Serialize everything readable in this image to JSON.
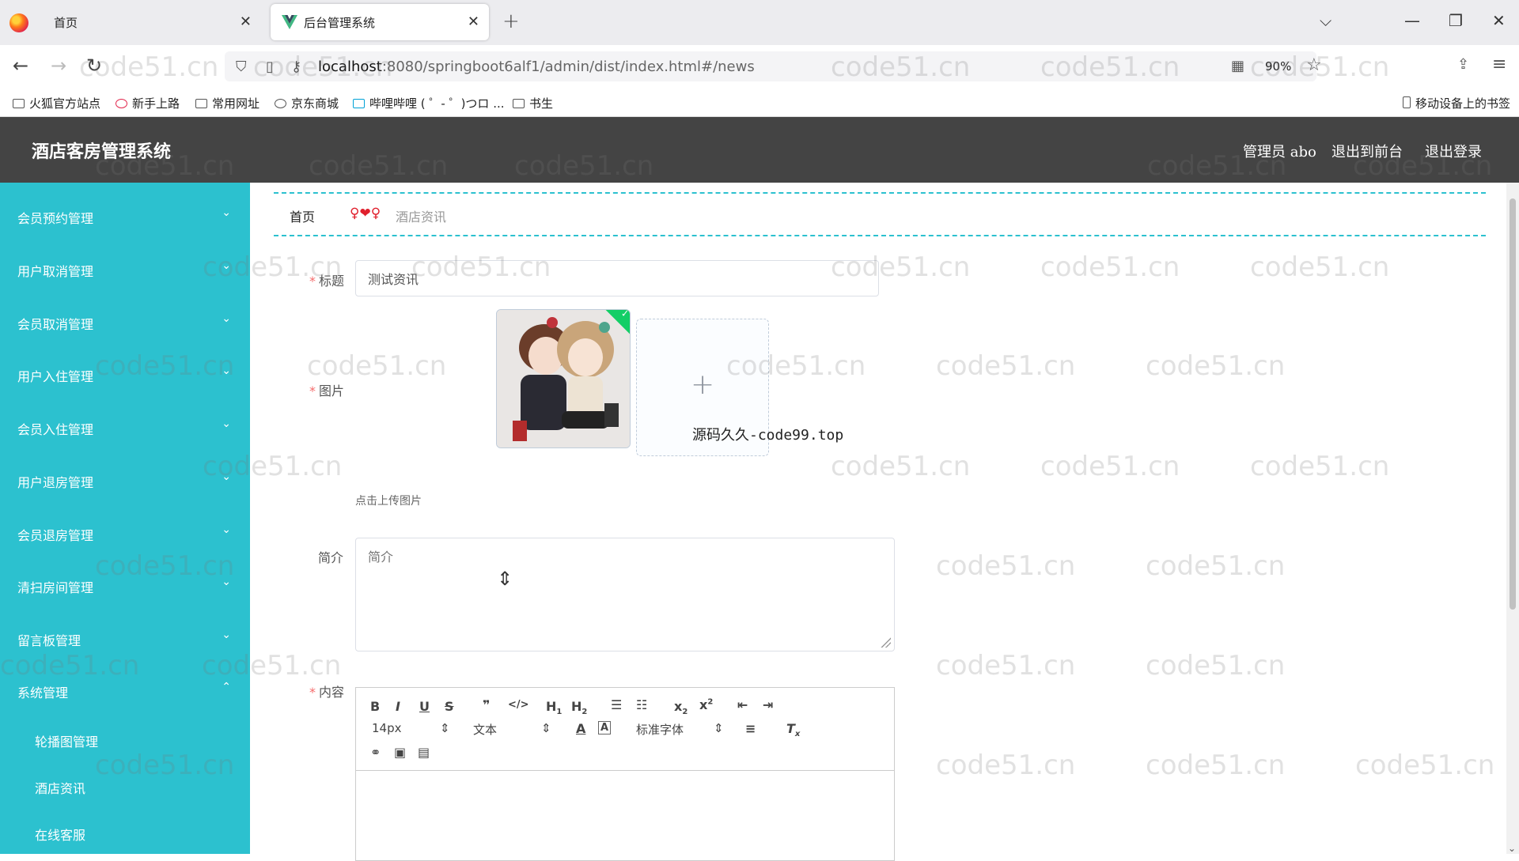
{
  "browser": {
    "tabs": [
      {
        "label": "首页"
      },
      {
        "label": "后台管理系统"
      }
    ],
    "url_host": "localhost",
    "url_rest": ":8080/springboot6alf1/admin/dist/index.html#/news",
    "zoom": "90%",
    "bookmarks": [
      "火狐官方站点",
      "新手上路",
      "常用网址",
      "京东商城",
      "哔哩哔哩 ( ゜- ゜)つロ ...",
      "书生"
    ],
    "mobile_bookmarks": "移动设备上的书签"
  },
  "header": {
    "title": "酒店客房管理系统",
    "admin": "管理员 abo",
    "to_front": "退出到前台",
    "logout": "退出登录"
  },
  "sidebar": {
    "items": [
      {
        "label": "会员预约管理"
      },
      {
        "label": "用户取消管理"
      },
      {
        "label": "会员取消管理"
      },
      {
        "label": "用户入住管理"
      },
      {
        "label": "会员入住管理"
      },
      {
        "label": "用户退房管理"
      },
      {
        "label": "会员退房管理"
      },
      {
        "label": "清扫房间管理"
      },
      {
        "label": "留言板管理"
      },
      {
        "label": "系统管理"
      }
    ],
    "sub_items": [
      {
        "label": "轮播图管理"
      },
      {
        "label": "酒店资讯"
      },
      {
        "label": "在线客服"
      }
    ]
  },
  "breadcrumb": {
    "home": "首页",
    "separator": "♀❤♀",
    "current": "酒店资讯"
  },
  "form": {
    "title_label": "标题",
    "title_value": "测试资讯",
    "image_label": "图片",
    "image_overlay": "源码久久-code99.top",
    "upload_tip": "点击上传图片",
    "intro_label": "简介",
    "intro_placeholder": "简介",
    "content_label": "内容"
  },
  "editor": {
    "font_size": "14px",
    "header_select": "文本",
    "font_family": "标准字体"
  },
  "watermark": "code51.cn",
  "colors": {
    "sidebar": "#2cc1cf",
    "header": "#444444",
    "required": "#f56c6c"
  }
}
